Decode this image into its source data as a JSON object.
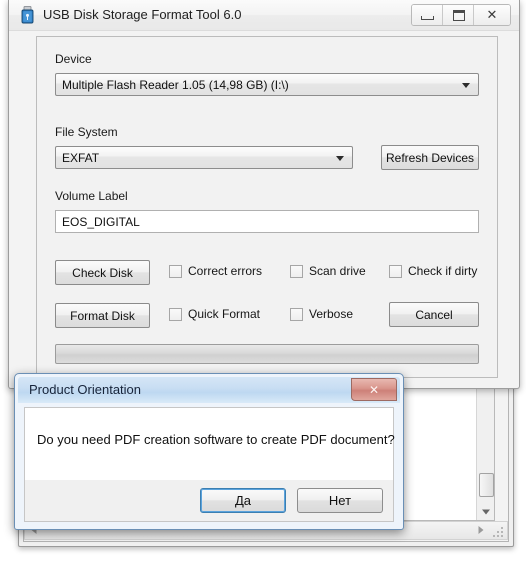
{
  "window": {
    "title": "USB Disk Storage Format Tool 6.0",
    "icon": "usb-drive-icon",
    "controls": {
      "minimize": "minimize",
      "maximize": "maximize",
      "close": "✕"
    }
  },
  "form": {
    "device": {
      "label": "Device",
      "value": "Multiple  Flash Reader  1.05 (14,98 GB) (I:\\)"
    },
    "file_system": {
      "label": "File System",
      "value": "EXFAT"
    },
    "refresh_button": "Refresh Devices",
    "volume_label": {
      "label": "Volume Label",
      "value": "EOS_DIGITAL"
    },
    "buttons": {
      "check_disk": "Check Disk",
      "format_disk": "Format Disk",
      "cancel": "Cancel"
    },
    "checkboxes": [
      {
        "label": "Correct errors",
        "checked": false
      },
      {
        "label": "Scan drive",
        "checked": false
      },
      {
        "label": "Check if dirty",
        "checked": false
      },
      {
        "label": "Quick Format",
        "checked": false
      },
      {
        "label": "Verbose",
        "checked": false
      }
    ],
    "progress": {
      "value": 0
    }
  },
  "dialog": {
    "title": "Product Orientation",
    "message": "Do you need PDF creation software to create PDF document?",
    "close_glyph": "✕",
    "buttons": {
      "yes": "Да",
      "no": "Нет"
    }
  },
  "colors": {
    "accent": "#3c7fb1",
    "dialog_close": "#cd8078",
    "window_bg": "#f2f2f2"
  }
}
